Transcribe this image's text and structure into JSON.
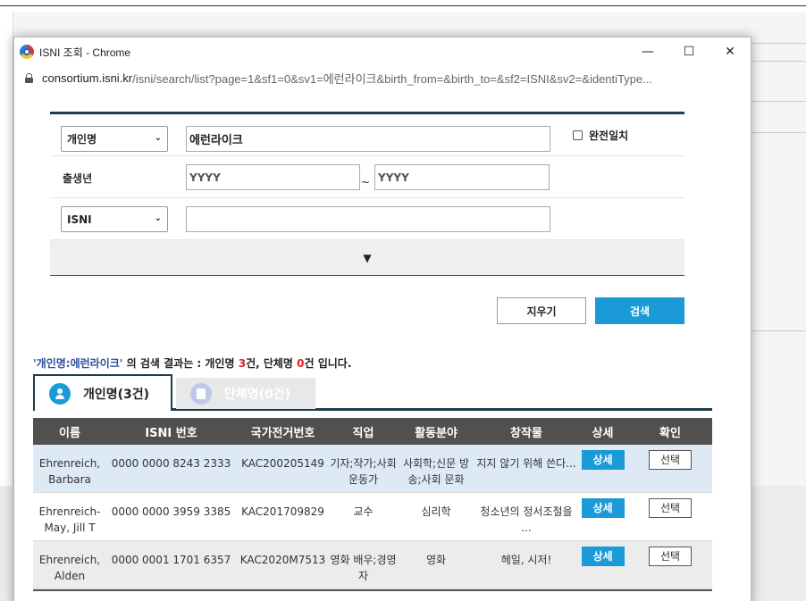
{
  "window": {
    "title": "ISNI 조회 - Chrome",
    "url_host": "consortium.isni.kr",
    "url_path": "/isni/search/list?page=1&sf1=0&sv1=에런라이크&birth_from=&birth_to=&sf2=ISNI&sv2=&identiType...",
    "minimize": "—",
    "maximize": "☐",
    "close": "✕"
  },
  "search": {
    "field1_select": "개인명",
    "field1_value": "에런라이크",
    "exact_match_label": "완전일치",
    "birth_label": "출생년",
    "birth_from_placeholder": "YYYY",
    "birth_to_placeholder": "YYYY",
    "tilde": "~",
    "field2_select": "ISNI",
    "field2_value": "",
    "expand_arrow": "▼",
    "clear_button": "지우기",
    "search_button": "검색",
    "chevron": "⌄"
  },
  "summary": {
    "query": "'개인명:에런라이크'",
    "text1": " 의 검색 결과는 : 개인명 ",
    "person_count": "3",
    "text2": "건, 단체명 ",
    "org_count": "0",
    "text3": "건 입니다."
  },
  "tabs": {
    "person": "개인명(3건)",
    "org": "단체명(0건)"
  },
  "table": {
    "headers": [
      "이름",
      "ISNI 번호",
      "국가전거번호",
      "직업",
      "활동분야",
      "창작물",
      "상세",
      "확인"
    ],
    "detail_label": "상세",
    "select_label": "선택",
    "rows": [
      {
        "name": "Ehrenreich, Barbara",
        "isni": "0000 0000 8243 2333",
        "kac": "KAC200205149",
        "job": "기자;작가;사회 운동가",
        "field": "사회학;신문 방송;사회 문화",
        "work": "지지 않기 위해 쓴다..."
      },
      {
        "name": "Ehrenreich-May, Jill T",
        "isni": "0000 0000 3959 3385",
        "kac": "KAC201709829",
        "job": "교수",
        "field": "심리학",
        "work": "청소년의 정서조절을 ..."
      },
      {
        "name": "Ehrenreich, Alden",
        "isni": "0000 0001 1701 6357",
        "kac": "KAC2020M7513",
        "job": "영화 배우;경영자",
        "field": "영화",
        "work": "헤일, 시저!"
      }
    ]
  }
}
